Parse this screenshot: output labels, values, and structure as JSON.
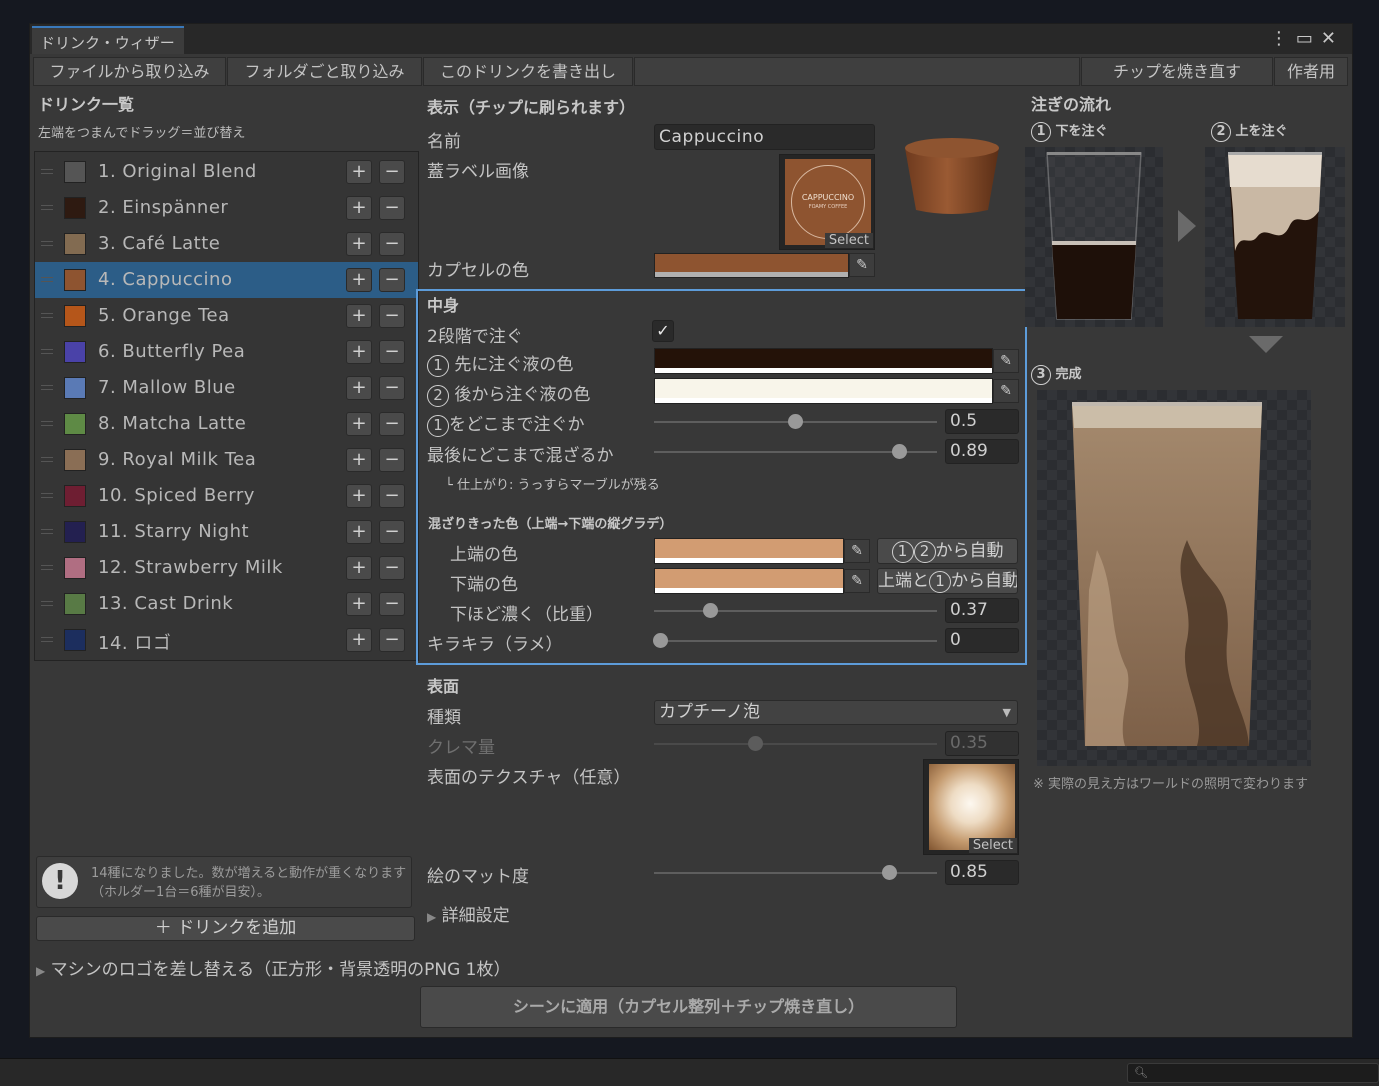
{
  "window": {
    "title": "ドリンク・ウィザード"
  },
  "toolbar": {
    "import_file": "ファイルから取り込み",
    "import_folder": "フォルダごと取り込み",
    "export_drink": "このドリンクを書き出し",
    "rebake_chips": "チップを焼き直す",
    "author": "作者用"
  },
  "drink_list": {
    "title": "ドリンク一覧",
    "hint": "左端をつまんでドラッグ＝並び替え",
    "items": [
      {
        "label": "1.  Original Blend",
        "color": "#555555"
      },
      {
        "label": "2.  Einspänner",
        "color": "#2e1a11"
      },
      {
        "label": "3.  Café Latte",
        "color": "#826b51"
      },
      {
        "label": "4.  Cappuccino",
        "color": "#8e5430"
      },
      {
        "label": "5.  Orange Tea",
        "color": "#b5561a"
      },
      {
        "label": "6.  Butterfly Pea",
        "color": "#4a42a8"
      },
      {
        "label": "7.  Mallow Blue",
        "color": "#5a7ab5"
      },
      {
        "label": "8.  Matcha Latte",
        "color": "#5e8a45"
      },
      {
        "label": "9.  Royal Milk Tea",
        "color": "#8a6e55"
      },
      {
        "label": "10.  Spiced Berry",
        "color": "#6e1e32"
      },
      {
        "label": "11.  Starry Night",
        "color": "#232050"
      },
      {
        "label": "12.  Strawberry Milk",
        "color": "#b06e82"
      },
      {
        "label": "13.  Cast Drink",
        "color": "#587a45"
      },
      {
        "label": "14.  ロゴ",
        "color": "#1c2e5e"
      }
    ],
    "plus": "+",
    "minus": "−",
    "selected_index": 3
  },
  "warning": {
    "text": "14種になりました。数が増えると動作が重くなります（ホルダー1台＝6種が目安）。"
  },
  "add_drink": "＋ ドリンクを追加",
  "logo_replace": "マシンのロゴを差し替える（正方形・背景透明のPNG 1枚）",
  "apply_button": "シーンに適用（カプセル整列＋チップ焼き直し）",
  "display": {
    "title": "表示（チップに刷られます）",
    "name_label": "名前",
    "name_value": "Cappuccino",
    "lid_label": "蓋ラベル画像",
    "lid_logo_line1": "CAPPUCCINO",
    "lid_logo_line2": "FOAMY COFFEE",
    "select": "Select",
    "capsule_color_label": "カプセルの色",
    "capsule_color": "#8e5430"
  },
  "contents": {
    "title": "中身",
    "two_stage_label": "2段階で注ぐ",
    "two_stage_checked": true,
    "first_color_label": "先に注ぐ液の色",
    "first_color": "#241208",
    "second_color_label": "後から注ぐ液の色",
    "second_color": "#f8f5ea",
    "pour_to_label": "をどこまで注ぐか",
    "pour_to_value": "0.5",
    "mix_label": "最後にどこまで混ざるか",
    "mix_value": "0.89",
    "finish_note": "└ 仕上がり: うっすらマーブルが残る",
    "gradient_title": "混ざりきった色（上端→下端の縦グラデ）",
    "top_color_label": "上端の色",
    "top_color": "#d29c72",
    "bottom_color_label": "下端の色",
    "bottom_color": "#d29c72",
    "auto_from_12": "から自動",
    "auto_top1_prefix": "上端と",
    "auto_top1_suffix": "から自動",
    "darker_label": "下ほど濃く（比重）",
    "darker_value": "0.37",
    "glitter_label": "キラキラ（ラメ）",
    "glitter_value": "0",
    "num1": "1",
    "num2": "2"
  },
  "surface": {
    "title": "表面",
    "type_label": "種類",
    "type_value": "カプチーノ泡",
    "crema_label": "クレマ量",
    "crema_value": "0.35",
    "texture_label": "表面のテクスチャ（任意）",
    "select": "Select",
    "matte_label": "絵のマット度",
    "matte_value": "0.85",
    "advanced": "詳細設定"
  },
  "pour_flow": {
    "title": "注ぎの流れ",
    "step1_num": "1",
    "step1": "下を注ぐ",
    "step2_num": "2",
    "step2": "上を注ぐ",
    "step3_num": "3",
    "step3": "完成",
    "note": "※ 実際の見え方はワールドの照明で変わります"
  }
}
